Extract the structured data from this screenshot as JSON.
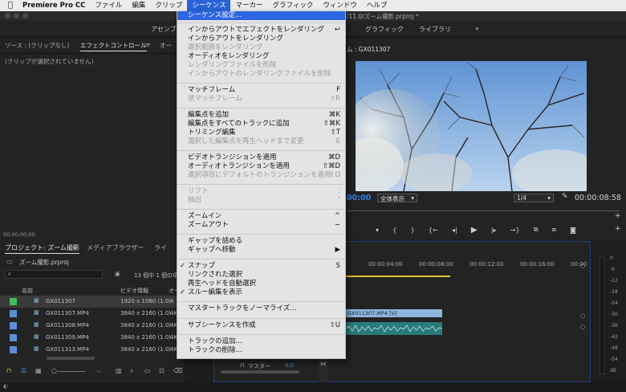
{
  "menubar": {
    "apple": "",
    "app": "Premiere Pro CC",
    "items": [
      "ファイル",
      "編集",
      "クリップ",
      "シーケンス",
      "マーカー",
      "グラフィック",
      "ウィンドウ",
      "ヘルプ"
    ]
  },
  "window": {
    "title": "/11.0/ズーム撮影.prproj *"
  },
  "workspaces": {
    "left": "アセンブリ",
    "graphics": "グラフィック",
    "libraries": "ライブラリ",
    "more": "»"
  },
  "effect_panel": {
    "tab_source": "ソース : (クリップなし)",
    "tab_effect": "エフェクトコントロール",
    "tab_more": "オー",
    "message": "(クリップが選択されていません)",
    "timecode": "00;00;00;00"
  },
  "program": {
    "title": "ム : GX011307",
    "timecode_current": "00:00",
    "zoom": "全体表示",
    "quality": "1/4",
    "timecode_duration": "00:00:08:58"
  },
  "project": {
    "tab_project": "プロジェクト: ズーム撮影",
    "tab_media": "メディアブラウザー",
    "tab_more": "ライ",
    "file": "ズーム撮影.prproj",
    "selection_info": "13 個中 1 個の項目",
    "col_name": "名前",
    "col_info": "ビデオ情報",
    "col_more": "オー",
    "items": [
      {
        "name": "GX011307",
        "info": "1920 x 1080 (1.0)",
        "extra": "4"
      },
      {
        "name": "GX011307.MP4",
        "info": "3840 x 2160 (1.0)",
        "extra": "4K"
      },
      {
        "name": "GX011308.MP4",
        "info": "3840 x 2160 (1.0)",
        "extra": "4K"
      },
      {
        "name": "GX011309.MP4",
        "info": "3840 x 2160 (1.0)",
        "extra": "4K"
      },
      {
        "name": "GX011313.MP4",
        "info": "3840 x 2160 (1.0)",
        "extra": "4K"
      }
    ]
  },
  "timeline": {
    "ruler": [
      "00:00:04:00",
      "00:00:08:00",
      "00:00:12:00",
      "00:00:16:00",
      "00:00"
    ],
    "clip_label": "GX011307.MP4 [V]",
    "master_label": "マスター",
    "master_value": "0.0"
  },
  "audio_meter": {
    "labels": [
      "0",
      "-6",
      "-12",
      "-18",
      "-24",
      "-30",
      "-36",
      "-42",
      "-48",
      "-54",
      "dB"
    ]
  },
  "sequence_menu": {
    "items": [
      {
        "label": "シーケンス設定...",
        "shortcut": "",
        "state": "highlight"
      },
      {
        "label": "インからアウトでエフェクトをレンダリング",
        "shortcut": "↩",
        "state": "normal"
      },
      {
        "label": "インからアウトをレンダリング",
        "shortcut": "",
        "state": "normal"
      },
      {
        "label": "選択範囲をレンダリング",
        "shortcut": "",
        "state": "disabled"
      },
      {
        "label": "オーディオをレンダリング",
        "shortcut": "",
        "state": "normal"
      },
      {
        "label": "レンダリングファイルを削除",
        "shortcut": "",
        "state": "disabled"
      },
      {
        "label": "インからアウトのレンダリングファイルを削除",
        "shortcut": "",
        "state": "disabled"
      },
      {
        "label": "マッチフレーム",
        "shortcut": "F",
        "state": "normal"
      },
      {
        "label": "逆マッチフレーム",
        "shortcut": "⇧R",
        "state": "disabled"
      },
      {
        "label": "編集点を追加",
        "shortcut": "⌘K",
        "state": "normal"
      },
      {
        "label": "編集点をすべてのトラックに追加",
        "shortcut": "⇧⌘K",
        "state": "normal"
      },
      {
        "label": "トリミング編集",
        "shortcut": "⇧T",
        "state": "normal"
      },
      {
        "label": "選択した編集点を再生ヘッドまで変更",
        "shortcut": "E",
        "state": "disabled"
      },
      {
        "label": "ビデオトランジションを適用",
        "shortcut": "⌘D",
        "state": "normal"
      },
      {
        "label": "オーディオトランジションを適用",
        "shortcut": "⇧⌘D",
        "state": "normal"
      },
      {
        "label": "選択項目にデフォルトのトランジションを適用",
        "shortcut": "⇧D",
        "state": "disabled"
      },
      {
        "label": "リフト",
        "shortcut": ";",
        "state": "disabled"
      },
      {
        "label": "抽出",
        "shortcut": "'",
        "state": "disabled"
      },
      {
        "label": "ズームイン",
        "shortcut": "^",
        "state": "normal"
      },
      {
        "label": "ズームアウト",
        "shortcut": "−",
        "state": "normal"
      },
      {
        "label": "ギャップを詰める",
        "shortcut": "",
        "state": "normal"
      },
      {
        "label": "ギャップへ移動",
        "shortcut": "▶",
        "state": "normal"
      },
      {
        "label": "スナップ",
        "shortcut": "S",
        "state": "checked"
      },
      {
        "label": "リンクされた選択",
        "shortcut": "",
        "state": "normal"
      },
      {
        "label": "再生ヘッドを自動選択",
        "shortcut": "",
        "state": "normal"
      },
      {
        "label": "スルー編集を表示",
        "shortcut": "",
        "state": "checked"
      },
      {
        "label": "マスタートラックをノーマライズ...",
        "shortcut": "",
        "state": "normal"
      },
      {
        "label": "サブシーケンスを作成",
        "shortcut": "⇧U",
        "state": "normal"
      },
      {
        "label": "トラックの追加...",
        "shortcut": "",
        "state": "normal"
      },
      {
        "label": "トラックの削除...",
        "shortcut": "",
        "state": "normal"
      }
    ]
  }
}
